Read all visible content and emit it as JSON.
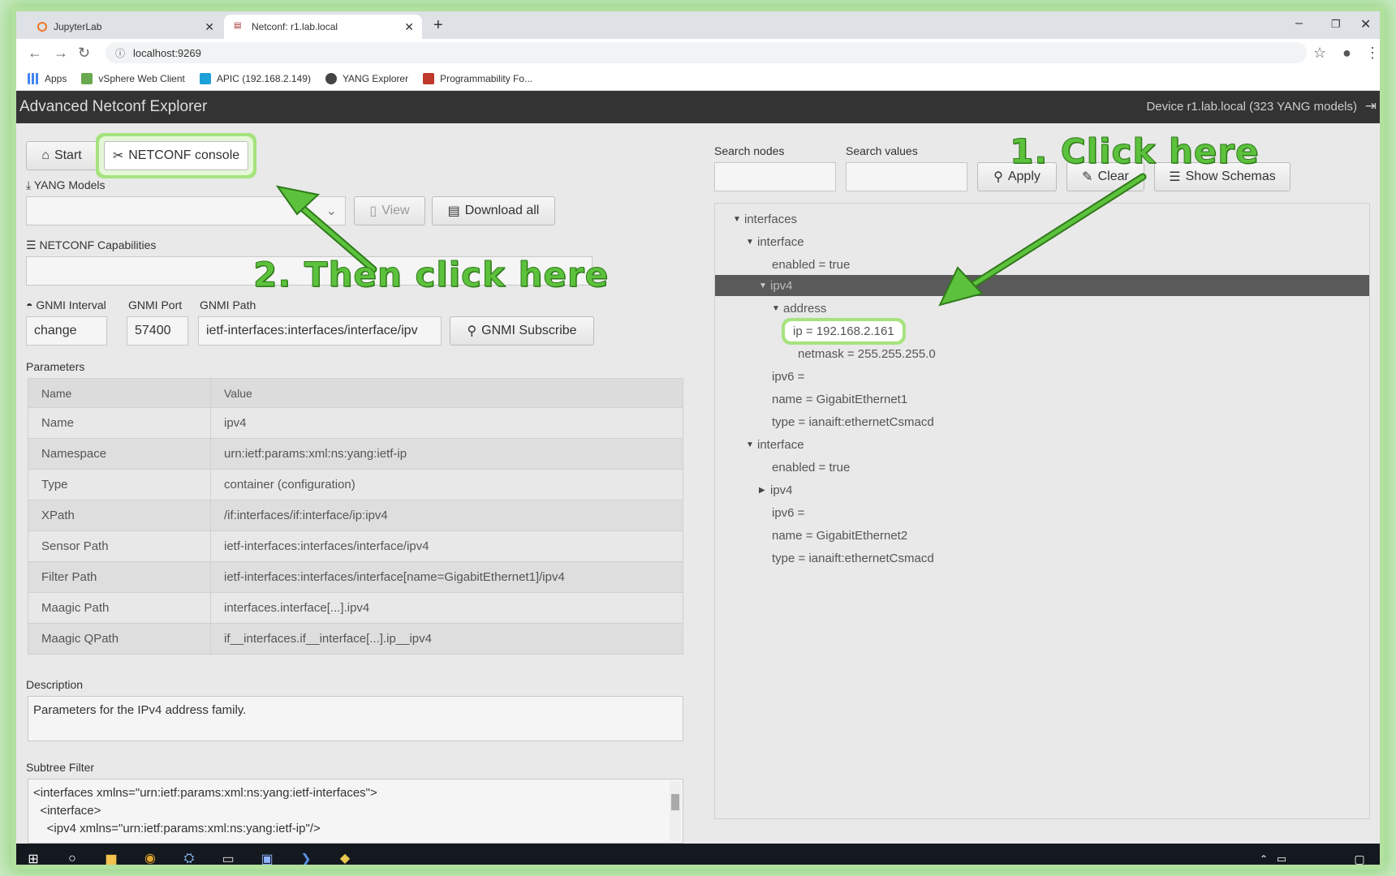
{
  "browser": {
    "tabs": [
      {
        "label": "JupyterLab"
      },
      {
        "label": "Netconf: r1.lab.local"
      }
    ],
    "url": "localhost:9269",
    "bookmarks": [
      {
        "label": "Apps"
      },
      {
        "label": "vSphere Web Client"
      },
      {
        "label": "APIC (192.168.2.149)"
      },
      {
        "label": "YANG Explorer"
      },
      {
        "label": "Programmability Fo..."
      }
    ]
  },
  "header": {
    "title": "Advanced Netconf Explorer",
    "device": "Device r1.lab.local (323 YANG models)"
  },
  "left": {
    "start_label": "Start",
    "console_label": "NETCONF console",
    "yang_models_label": "YANG Models",
    "view_label": "View",
    "download_all_label": "Download all",
    "capabilities_label": "NETCONF Capabilities",
    "gnmi_interval_label": "GNMI Interval",
    "gnmi_port_label": "GNMI Port",
    "gnmi_path_label": "GNMI Path",
    "gnmi_interval_value": "change",
    "gnmi_port_value": "57400",
    "gnmi_path_value": "ietf-interfaces:interfaces/interface/ipv",
    "gnmi_subscribe_label": "GNMI Subscribe",
    "parameters_label": "Parameters",
    "table_headers": [
      "Name",
      "Value"
    ],
    "parameters": [
      {
        "name": "Name",
        "value": "ipv4"
      },
      {
        "name": "Namespace",
        "value": "urn:ietf:params:xml:ns:yang:ietf-ip"
      },
      {
        "name": "Type",
        "value": "container (configuration)"
      },
      {
        "name": "XPath",
        "value": "/if:interfaces/if:interface/ip:ipv4"
      },
      {
        "name": "Sensor Path",
        "value": "ietf-interfaces:interfaces/interface/ipv4"
      },
      {
        "name": "Filter Path",
        "value": "ietf-interfaces:interfaces/interface[name=GigabitEthernet1]/ipv4"
      },
      {
        "name": "Maagic Path",
        "value": "interfaces.interface[...].ipv4"
      },
      {
        "name": "Maagic QPath",
        "value": "if__interfaces.if__interface[...].ip__ipv4"
      }
    ],
    "description_label": "Description",
    "description": "Parameters for the IPv4 address family.",
    "subtree_label": "Subtree Filter",
    "subtree_lines": [
      "<interfaces xmlns=\"urn:ietf:params:xml:ns:yang:ietf-interfaces\">",
      "  <interface>",
      "    <ipv4 xmlns=\"urn:ietf:params:xml:ns:yang:ietf-ip\"/>"
    ]
  },
  "right": {
    "search_nodes_label": "Search nodes",
    "search_values_label": "Search values",
    "apply_label": "Apply",
    "clear_label": "Clear",
    "show_schemas_label": "Show Schemas",
    "tree": [
      {
        "text": "interfaces",
        "caret": "down"
      },
      {
        "text": "interface",
        "caret": "down"
      },
      {
        "text": "enabled = true",
        "caret": ""
      },
      {
        "text": "ipv4",
        "caret": "down"
      },
      {
        "text": "address",
        "caret": "down"
      },
      {
        "text": "ip = 192.168.2.161",
        "caret": ""
      },
      {
        "text": "netmask = 255.255.255.0",
        "caret": ""
      },
      {
        "text": "ipv6 =",
        "caret": ""
      },
      {
        "text": "name = GigabitEthernet1",
        "caret": ""
      },
      {
        "text": "type = ianaift:ethernetCsmacd",
        "caret": ""
      },
      {
        "text": "interface",
        "caret": "down"
      },
      {
        "text": "enabled = true",
        "caret": ""
      },
      {
        "text": "ipv4",
        "caret": "right"
      },
      {
        "text": "ipv6 =",
        "caret": ""
      },
      {
        "text": "name = GigabitEthernet2",
        "caret": ""
      },
      {
        "text": "type = ianaift:ethernetCsmacd",
        "caret": ""
      }
    ]
  },
  "annotations": {
    "step1": "1. Click here",
    "step2": "2. Then click here",
    "color": "#5cc13c"
  },
  "icons": {
    "start": "home-icon",
    "console": "tools-icon",
    "yang_models": "download-icon",
    "capabilities": "list-icon",
    "gnmi_interval": "gauge-icon",
    "subscribe": "user-search-icon",
    "apply": "search-icon",
    "clear": "eraser-icon",
    "schemas": "list-icon"
  }
}
